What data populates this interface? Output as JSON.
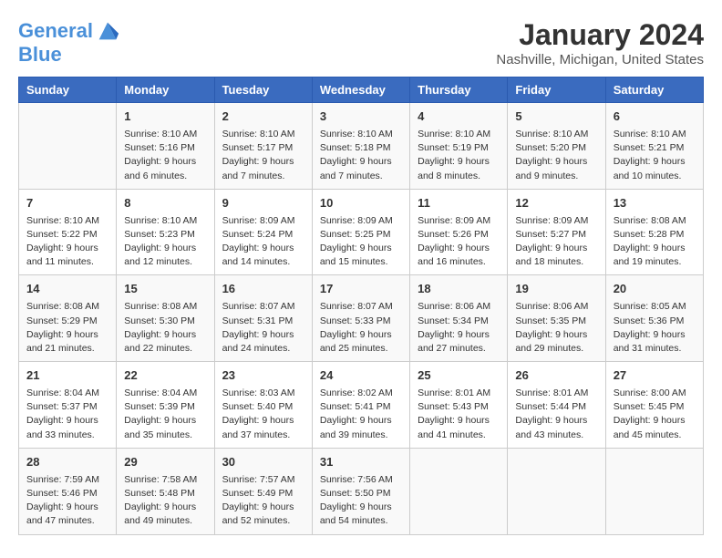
{
  "logo": {
    "line1": "General",
    "line2": "Blue"
  },
  "title": "January 2024",
  "subtitle": "Nashville, Michigan, United States",
  "headers": [
    "Sunday",
    "Monday",
    "Tuesday",
    "Wednesday",
    "Thursday",
    "Friday",
    "Saturday"
  ],
  "weeks": [
    [
      {
        "day": "",
        "info": ""
      },
      {
        "day": "1",
        "info": "Sunrise: 8:10 AM\nSunset: 5:16 PM\nDaylight: 9 hours\nand 6 minutes."
      },
      {
        "day": "2",
        "info": "Sunrise: 8:10 AM\nSunset: 5:17 PM\nDaylight: 9 hours\nand 7 minutes."
      },
      {
        "day": "3",
        "info": "Sunrise: 8:10 AM\nSunset: 5:18 PM\nDaylight: 9 hours\nand 7 minutes."
      },
      {
        "day": "4",
        "info": "Sunrise: 8:10 AM\nSunset: 5:19 PM\nDaylight: 9 hours\nand 8 minutes."
      },
      {
        "day": "5",
        "info": "Sunrise: 8:10 AM\nSunset: 5:20 PM\nDaylight: 9 hours\nand 9 minutes."
      },
      {
        "day": "6",
        "info": "Sunrise: 8:10 AM\nSunset: 5:21 PM\nDaylight: 9 hours\nand 10 minutes."
      }
    ],
    [
      {
        "day": "7",
        "info": "Sunrise: 8:10 AM\nSunset: 5:22 PM\nDaylight: 9 hours\nand 11 minutes."
      },
      {
        "day": "8",
        "info": "Sunrise: 8:10 AM\nSunset: 5:23 PM\nDaylight: 9 hours\nand 12 minutes."
      },
      {
        "day": "9",
        "info": "Sunrise: 8:09 AM\nSunset: 5:24 PM\nDaylight: 9 hours\nand 14 minutes."
      },
      {
        "day": "10",
        "info": "Sunrise: 8:09 AM\nSunset: 5:25 PM\nDaylight: 9 hours\nand 15 minutes."
      },
      {
        "day": "11",
        "info": "Sunrise: 8:09 AM\nSunset: 5:26 PM\nDaylight: 9 hours\nand 16 minutes."
      },
      {
        "day": "12",
        "info": "Sunrise: 8:09 AM\nSunset: 5:27 PM\nDaylight: 9 hours\nand 18 minutes."
      },
      {
        "day": "13",
        "info": "Sunrise: 8:08 AM\nSunset: 5:28 PM\nDaylight: 9 hours\nand 19 minutes."
      }
    ],
    [
      {
        "day": "14",
        "info": "Sunrise: 8:08 AM\nSunset: 5:29 PM\nDaylight: 9 hours\nand 21 minutes."
      },
      {
        "day": "15",
        "info": "Sunrise: 8:08 AM\nSunset: 5:30 PM\nDaylight: 9 hours\nand 22 minutes."
      },
      {
        "day": "16",
        "info": "Sunrise: 8:07 AM\nSunset: 5:31 PM\nDaylight: 9 hours\nand 24 minutes."
      },
      {
        "day": "17",
        "info": "Sunrise: 8:07 AM\nSunset: 5:33 PM\nDaylight: 9 hours\nand 25 minutes."
      },
      {
        "day": "18",
        "info": "Sunrise: 8:06 AM\nSunset: 5:34 PM\nDaylight: 9 hours\nand 27 minutes."
      },
      {
        "day": "19",
        "info": "Sunrise: 8:06 AM\nSunset: 5:35 PM\nDaylight: 9 hours\nand 29 minutes."
      },
      {
        "day": "20",
        "info": "Sunrise: 8:05 AM\nSunset: 5:36 PM\nDaylight: 9 hours\nand 31 minutes."
      }
    ],
    [
      {
        "day": "21",
        "info": "Sunrise: 8:04 AM\nSunset: 5:37 PM\nDaylight: 9 hours\nand 33 minutes."
      },
      {
        "day": "22",
        "info": "Sunrise: 8:04 AM\nSunset: 5:39 PM\nDaylight: 9 hours\nand 35 minutes."
      },
      {
        "day": "23",
        "info": "Sunrise: 8:03 AM\nSunset: 5:40 PM\nDaylight: 9 hours\nand 37 minutes."
      },
      {
        "day": "24",
        "info": "Sunrise: 8:02 AM\nSunset: 5:41 PM\nDaylight: 9 hours\nand 39 minutes."
      },
      {
        "day": "25",
        "info": "Sunrise: 8:01 AM\nSunset: 5:43 PM\nDaylight: 9 hours\nand 41 minutes."
      },
      {
        "day": "26",
        "info": "Sunrise: 8:01 AM\nSunset: 5:44 PM\nDaylight: 9 hours\nand 43 minutes."
      },
      {
        "day": "27",
        "info": "Sunrise: 8:00 AM\nSunset: 5:45 PM\nDaylight: 9 hours\nand 45 minutes."
      }
    ],
    [
      {
        "day": "28",
        "info": "Sunrise: 7:59 AM\nSunset: 5:46 PM\nDaylight: 9 hours\nand 47 minutes."
      },
      {
        "day": "29",
        "info": "Sunrise: 7:58 AM\nSunset: 5:48 PM\nDaylight: 9 hours\nand 49 minutes."
      },
      {
        "day": "30",
        "info": "Sunrise: 7:57 AM\nSunset: 5:49 PM\nDaylight: 9 hours\nand 52 minutes."
      },
      {
        "day": "31",
        "info": "Sunrise: 7:56 AM\nSunset: 5:50 PM\nDaylight: 9 hours\nand 54 minutes."
      },
      {
        "day": "",
        "info": ""
      },
      {
        "day": "",
        "info": ""
      },
      {
        "day": "",
        "info": ""
      }
    ]
  ]
}
